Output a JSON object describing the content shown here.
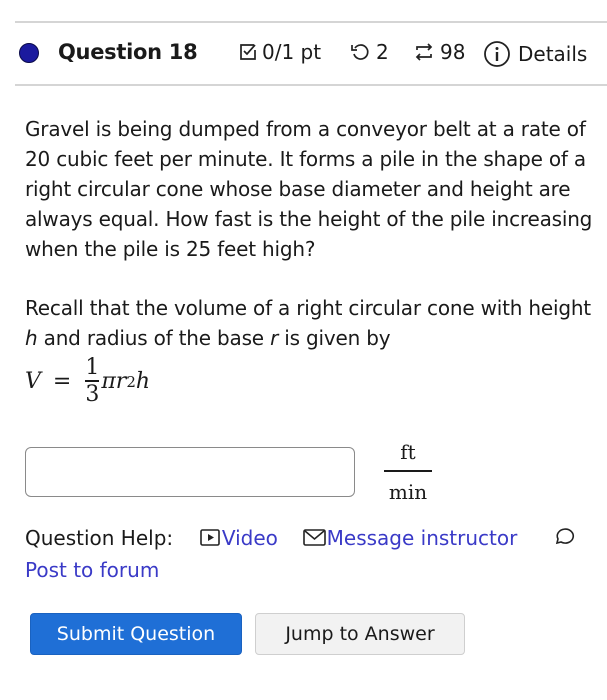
{
  "question": {
    "title": "Question 18",
    "score": "0/1 pt",
    "retries": "2",
    "attempts": "98",
    "details_label": "Details",
    "status_color": "#1b1a9e"
  },
  "problem": {
    "paragraph1": "Gravel is being dumped from a conveyor belt at a rate of 20 cubic feet per minute. It forms a pile in the shape of a right circular cone whose base diameter and height are always equal. How fast is the height of the pile increasing when the pile is 25 feet high?",
    "recall_prefix": "Recall that the volume of a right circular cone with height ",
    "recall_h": "h",
    "recall_mid": " and radius of the base ",
    "recall_r": "r",
    "recall_suffix": " is given by",
    "formula": {
      "lhs": "V",
      "equals": "=",
      "numerator": "1",
      "denominator": "3",
      "rest_pi": "π",
      "rest_r": "r",
      "rest_exp": "2",
      "rest_h": "h"
    }
  },
  "answer": {
    "value": "",
    "placeholder": "",
    "unit_numerator": "ft",
    "unit_denominator": "min"
  },
  "help": {
    "label": "Question Help:",
    "video": "Video",
    "message": "Message instructor",
    "forum": "Post to forum",
    "link_color": "#3a3ac7"
  },
  "buttons": {
    "submit": "Submit Question",
    "jump": "Jump to Answer",
    "primary_color": "#1f6fd6"
  }
}
